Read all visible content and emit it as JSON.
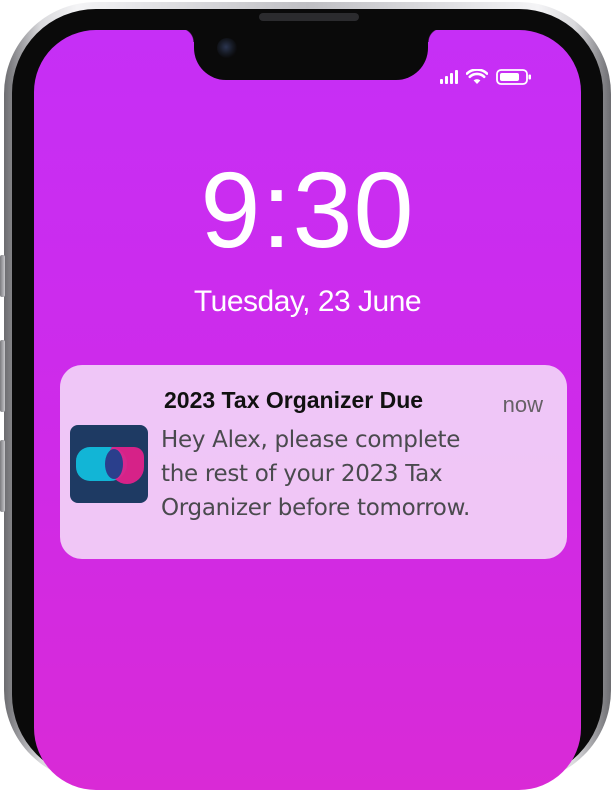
{
  "lock_screen": {
    "time": "9:30",
    "date": "Tuesday, 23 June"
  },
  "status_bar": {
    "signal_icon": "cellular-signal-icon",
    "wifi_icon": "wifi-icon",
    "battery_icon": "battery-icon"
  },
  "notification": {
    "title": "2023 Tax Organizer Due",
    "time": "now",
    "body": "Hey Alex, please complete the rest of your 2023 Tax Organizer before tomorrow.",
    "app_icon": "app-logo-icon"
  },
  "colors": {
    "wallpaper_top": "#c62ff6",
    "wallpaper_bottom": "#d92ad6",
    "icon_background": "#1e3a63",
    "icon_cyan": "#12b5d6",
    "icon_magenta": "#e0218a"
  }
}
